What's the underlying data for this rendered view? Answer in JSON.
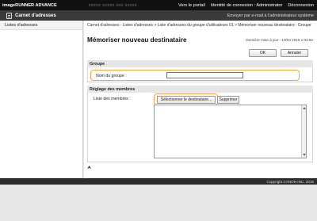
{
  "topbar": {
    "brand": "imageRUNNER ADVANCE",
    "blurred_text": "xxxxx xxxxx xxx xxxxx",
    "portal": "Vers le portail",
    "login_label": "Identité de connexion : Administrator",
    "logout": "Déconnexion"
  },
  "titlebar": {
    "title": "Carnet d'adresses",
    "mail_admin": "Envoyer par e-mail à l'administrateur système"
  },
  "sidebar": {
    "items": [
      {
        "label": "Listes d'adresses"
      }
    ]
  },
  "main": {
    "breadcrumb": "Carnet d'adresses : Listes d'adresses > Liste d'adresses du groupe d'utilisateurs 01 > Mémoriser nouveau destinataire : Groupe",
    "title": "Mémoriser nouveau destinataire",
    "last_updated": "Dernière mise à jour : 10/04 2015 1:01:52",
    "ok": "OK",
    "cancel": "Annuler",
    "group_section": "Groupe",
    "group_name_label": "Nom du groupe :",
    "group_name_value": "",
    "members_section": "Réglage des membres",
    "members_label": "Liste des membres :",
    "select_recipient": "Sélectionner le destinataire...",
    "delete": "Supprimer",
    "members": [],
    "top_link": "⮝"
  },
  "footer": {
    "copyright": "Copyright CANON INC. 2015"
  },
  "colors": {
    "highlight": "#f0a94a",
    "topbar_bg": "#111111",
    "titlebar_bg": "#3a3a3a"
  }
}
